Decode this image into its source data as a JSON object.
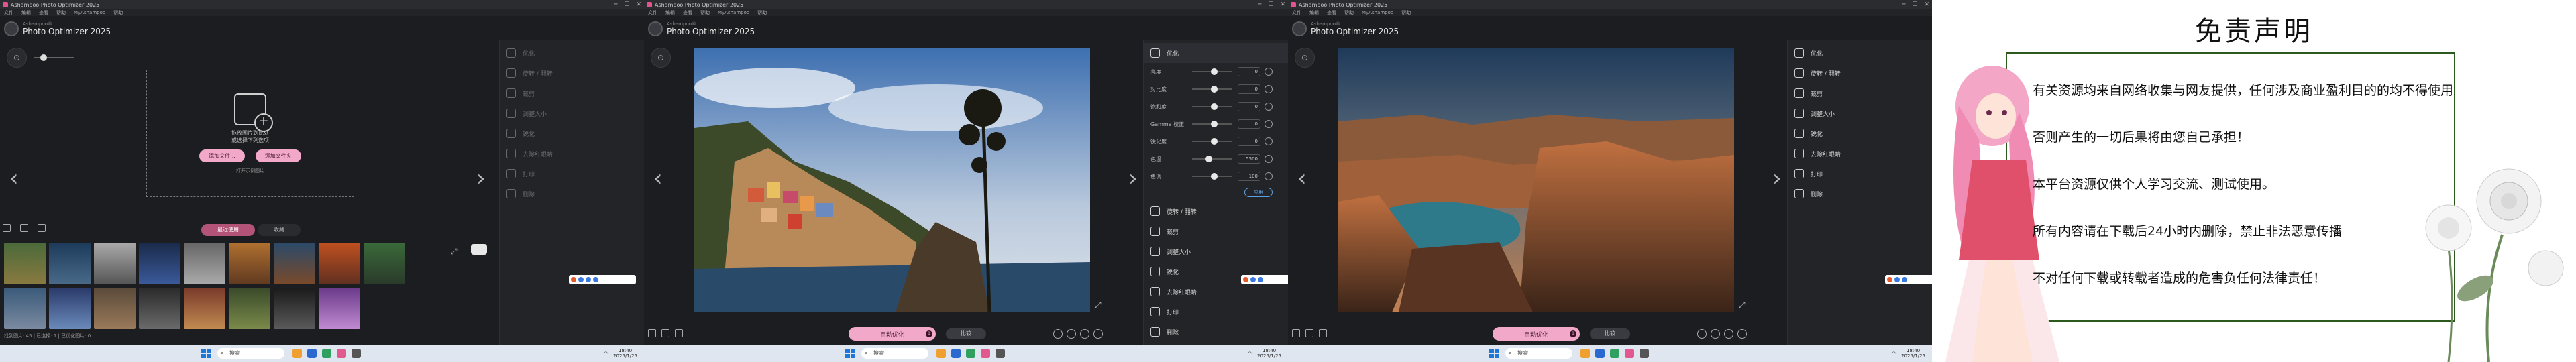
{
  "app": {
    "window_title": "Ashampoo Photo Optimizer 2025",
    "vendor": "Ashampoo®",
    "name": "Photo Optimizer 2025",
    "menu": [
      "文件",
      "编辑",
      "查看",
      "帮助",
      "MyAshampoo",
      "帮助"
    ]
  },
  "sidebar_items": [
    {
      "label": "优化",
      "icon": "magic-wand-icon"
    },
    {
      "label": "旋转 / 翻转",
      "icon": "rotate-icon"
    },
    {
      "label": "裁剪",
      "icon": "crop-icon"
    },
    {
      "label": "调整大小",
      "icon": "resize-icon"
    },
    {
      "label": "锐化",
      "icon": "sharpen-icon"
    },
    {
      "label": "去除红眼睛",
      "icon": "red-eye-icon"
    },
    {
      "label": "打印",
      "icon": "print-icon"
    },
    {
      "label": "删除",
      "icon": "delete-icon"
    }
  ],
  "panel1": {
    "drop_text_1": "拖放图片到此处",
    "drop_text_2": "或选择下列选项",
    "btn_open_files": "添加文件...",
    "btn_open_folder": "添加文件夹",
    "drop_footer": "打开示例图片",
    "gallery_tabs": [
      "最近使用",
      "收藏"
    ],
    "status": "找到图片: 45 | 已选择: 1 | 已优化图片: 0"
  },
  "panel2": {
    "adjustments": [
      {
        "label": "亮度",
        "value": "0"
      },
      {
        "label": "对比度",
        "value": "0"
      },
      {
        "label": "饱和度",
        "value": "0"
      },
      {
        "label": "Gamma 校正",
        "value": "0"
      },
      {
        "label": "锐化度",
        "value": "0"
      },
      {
        "label": "色温",
        "value": "5500"
      },
      {
        "label": "色调",
        "value": "100"
      }
    ],
    "apply_label": "应用"
  },
  "bottom": {
    "optimize_label": "自动优化",
    "count": "1",
    "secondary_label": "比较"
  },
  "taskbar": {
    "search_placeholder": "搜索",
    "time": "18:40",
    "date": "2025/1/25"
  },
  "disclaimer": {
    "title": "免责声明",
    "lines": [
      "有关资源均来自网络收集与网友提供，任何涉及商业盈利目的的均不得使用",
      "否则产生的一切后果将由您自己承担！",
      "本平台资源仅供个人学习交流、测试使用。",
      "所有内容请在下载后24小时内删除，禁止非法恶意传播",
      "不对任何下载或转载者造成的危害负任何法律责任！"
    ]
  },
  "colors": {
    "accent_pink": "#f2a8c8",
    "apply_blue": "#5aa0e6",
    "frame_green": "#2b5a1c"
  }
}
